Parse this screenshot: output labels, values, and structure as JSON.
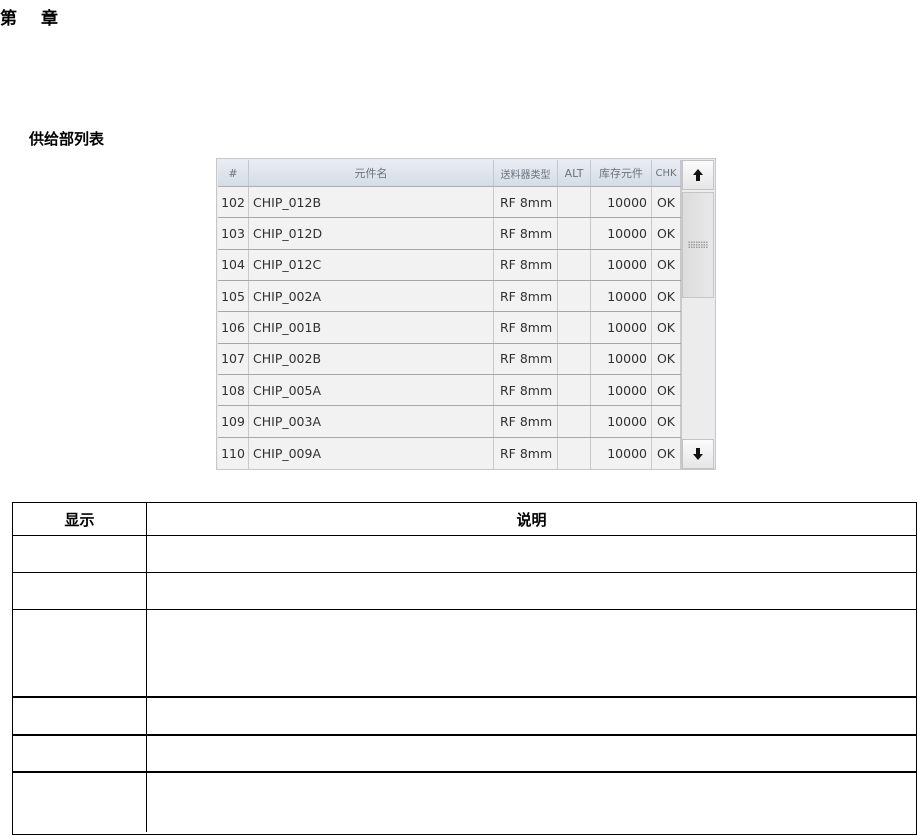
{
  "page": {
    "chapter_first": "第",
    "chapter_second": "章",
    "section_title": "供给部列表"
  },
  "feeder_list": {
    "columns": [
      "#",
      "元件名",
      "送料器类型",
      "ALT",
      "库存元件",
      "CHK"
    ],
    "rows": [
      {
        "num": "102",
        "name": "CHIP_012B",
        "type": "RF 8mm",
        "alt": "",
        "stock": "10000",
        "chk": "OK"
      },
      {
        "num": "103",
        "name": "CHIP_012D",
        "type": "RF 8mm",
        "alt": "",
        "stock": "10000",
        "chk": "OK"
      },
      {
        "num": "104",
        "name": "CHIP_012C",
        "type": "RF 8mm",
        "alt": "",
        "stock": "10000",
        "chk": "OK"
      },
      {
        "num": "105",
        "name": "CHIP_002A",
        "type": "RF 8mm",
        "alt": "",
        "stock": "10000",
        "chk": "OK"
      },
      {
        "num": "106",
        "name": "CHIP_001B",
        "type": "RF 8mm",
        "alt": "",
        "stock": "10000",
        "chk": "OK"
      },
      {
        "num": "107",
        "name": "CHIP_002B",
        "type": "RF 8mm",
        "alt": "",
        "stock": "10000",
        "chk": "OK"
      },
      {
        "num": "108",
        "name": "CHIP_005A",
        "type": "RF 8mm",
        "alt": "",
        "stock": "10000",
        "chk": "OK"
      },
      {
        "num": "109",
        "name": "CHIP_003A",
        "type": "RF 8mm",
        "alt": "",
        "stock": "10000",
        "chk": "OK"
      },
      {
        "num": "110",
        "name": "CHIP_009A",
        "type": "RF 8mm",
        "alt": "",
        "stock": "10000",
        "chk": "OK"
      }
    ],
    "scroll_up_icon": "arrow-up-icon",
    "scroll_down_icon": "arrow-down-icon"
  },
  "description_table": {
    "headers": [
      "显示",
      "说明"
    ],
    "rows": [
      {
        "display": "",
        "description": ""
      },
      {
        "display": "",
        "description": ""
      },
      {
        "display": "",
        "description": ""
      },
      {
        "display": "",
        "description": ""
      },
      {
        "display": "",
        "description": ""
      },
      {
        "display": "",
        "description": ""
      }
    ]
  }
}
